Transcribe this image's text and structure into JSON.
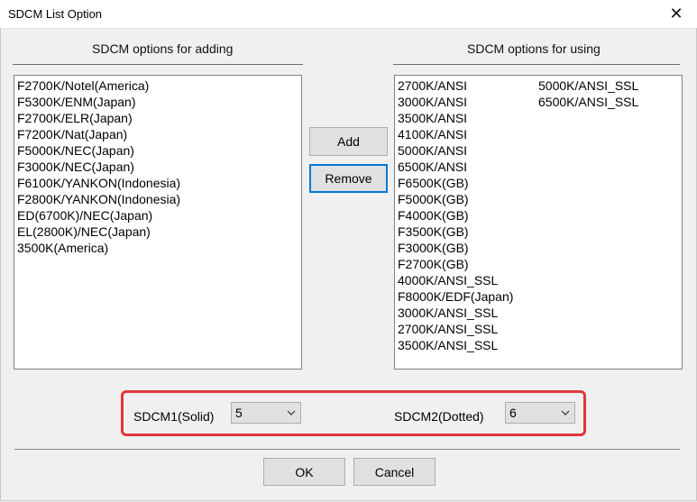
{
  "window": {
    "title": "SDCM List Option",
    "close_glyph": "✕"
  },
  "left": {
    "label": "SDCM options for adding",
    "items": [
      "F2700K/Notel(America)",
      "F5300K/ENM(Japan)",
      "F2700K/ELR(Japan)",
      "F7200K/Nat(Japan)",
      "F5000K/NEC(Japan)",
      "F3000K/NEC(Japan)",
      "F6100K/YANKON(Indonesia)",
      "F2800K/YANKON(Indonesia)",
      "ED(6700K)/NEC(Japan)",
      "EL(2800K)/NEC(Japan)",
      "3500K(America)"
    ]
  },
  "right": {
    "label": "SDCM options for using",
    "items": [
      "2700K/ANSI",
      "3000K/ANSI",
      "3500K/ANSI",
      "4100K/ANSI",
      "5000K/ANSI",
      "6500K/ANSI",
      "F6500K(GB)",
      "F5000K(GB)",
      "F4000K(GB)",
      "F3500K(GB)",
      "F3000K(GB)",
      "F2700K(GB)",
      "4000K/ANSI_SSL",
      "F8000K/EDF(Japan)",
      "3000K/ANSI_SSL",
      "2700K/ANSI_SSL",
      "3500K/ANSI_SSL",
      "5000K/ANSI_SSL",
      "6500K/ANSI_SSL"
    ]
  },
  "buttons": {
    "add": "Add",
    "remove": "Remove",
    "ok": "OK",
    "cancel": "Cancel"
  },
  "sdcm1": {
    "label": "SDCM1(Solid)",
    "value": "5"
  },
  "sdcm2": {
    "label": "SDCM2(Dotted)",
    "value": "6"
  },
  "colors": {
    "highlight": "#e0373c",
    "focus": "#0078d7"
  }
}
